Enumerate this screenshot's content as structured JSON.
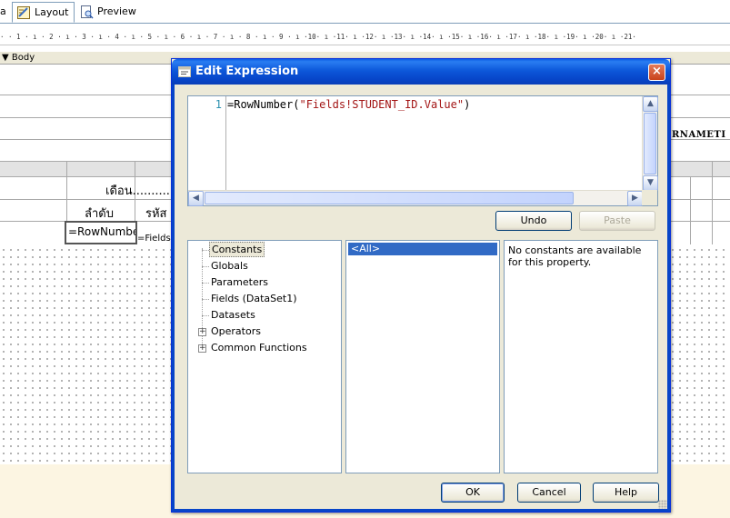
{
  "tabs": {
    "cut_label": "a",
    "layout_label": "Layout",
    "preview_label": "Preview"
  },
  "ruler": {
    "text": "· · 1 · ı · 2 · ı · 3 · ı · 4 · ı · 5 · ı · 6 · ı · 7 · ı · 8 · ı · 9 · ı ·10· ı ·11· ı ·12· ı ·13· ı ·14· ı ·15· ı ·16· ı ·17· ı ·18· ı ·19· ı ·20· ı ·21·"
  },
  "design": {
    "body_label": "Body",
    "month_label": "เดือน...........",
    "order_label": "ลำดับ",
    "code_label": "รหัส",
    "rownum_cell": "=RowNumber",
    "fields_cell": "=Fields",
    "surname_cell": "RNAMETI"
  },
  "dialog": {
    "title": "Edit Expression",
    "close_glyph": "×",
    "editor": {
      "line_number": "1",
      "code_prefix": "=RowNumber(",
      "code_string": "\"Fields!STUDENT_ID.Value\"",
      "code_suffix": ")"
    },
    "undo_label": "Undo",
    "paste_label": "Paste",
    "categories": [
      {
        "label": "Constants"
      },
      {
        "label": "Globals"
      },
      {
        "label": "Parameters"
      },
      {
        "label": "Fields (DataSet1)"
      },
      {
        "label": "Datasets"
      },
      {
        "label": "Operators"
      },
      {
        "label": "Common Functions"
      }
    ],
    "items_selected": "<All>",
    "description": "No constants are available for this property.",
    "ok_label": "OK",
    "cancel_label": "Cancel",
    "help_label": "Help"
  },
  "colors": {
    "title_bar": "#0745c8",
    "selection": "#316ac5",
    "string_literal": "#a31515",
    "line_number": "#2b91af"
  }
}
